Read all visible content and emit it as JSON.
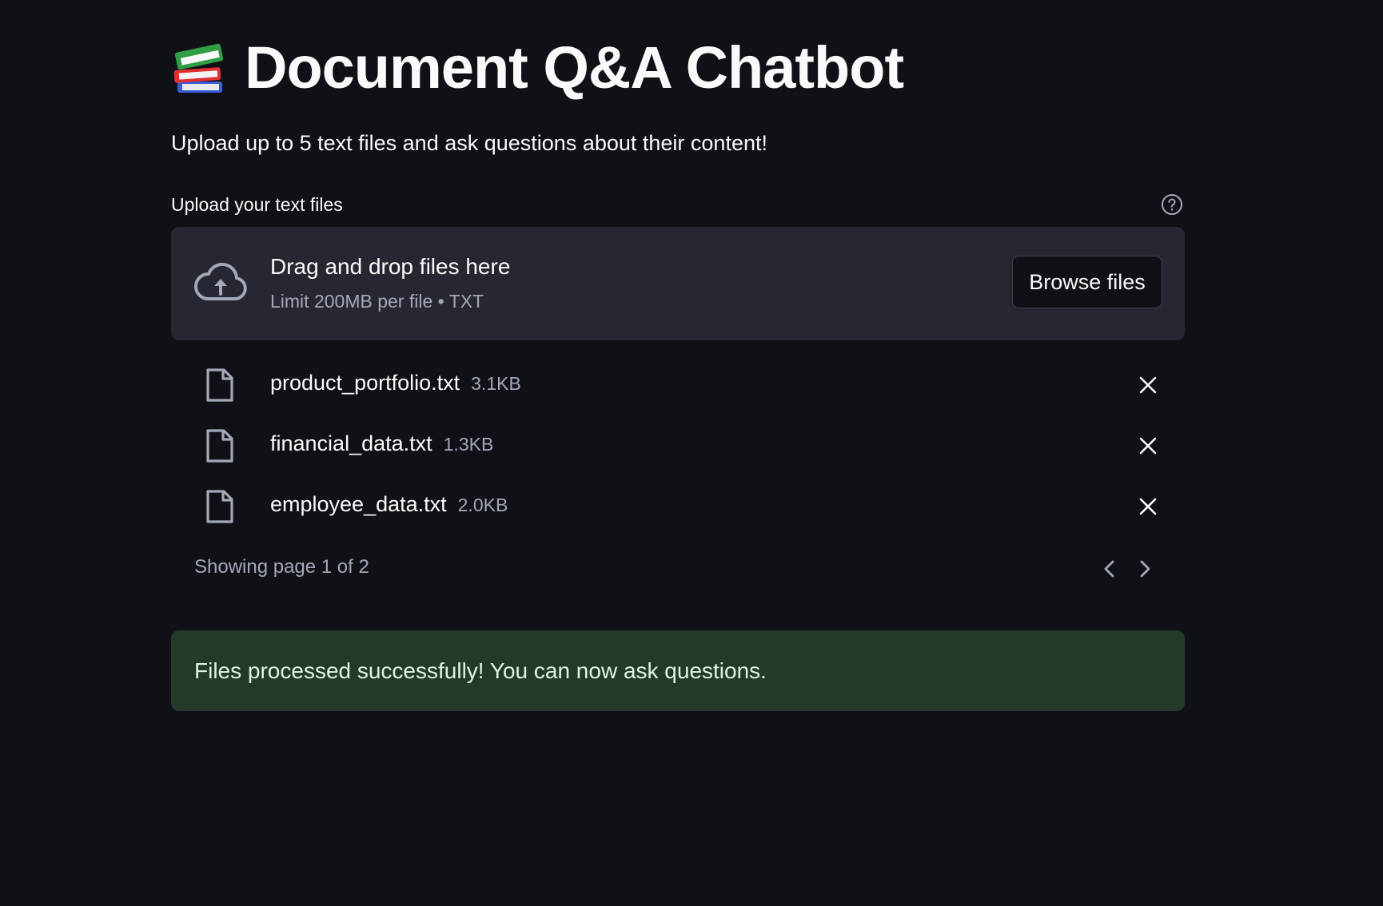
{
  "header": {
    "icon": "books-icon",
    "title": "Document Q&A Chatbot",
    "subtitle": "Upload up to 5 text files and ask questions about their content!"
  },
  "uploader": {
    "label": "Upload your text files",
    "help_icon": "question-circle-icon",
    "dropzone": {
      "icon": "cloud-upload-icon",
      "title": "Drag and drop files here",
      "limit": "Limit 200MB per file • TXT"
    },
    "browse_label": "Browse files",
    "files": [
      {
        "name": "product_portfolio.txt",
        "size": "3.1KB"
      },
      {
        "name": "financial_data.txt",
        "size": "1.3KB"
      },
      {
        "name": "employee_data.txt",
        "size": "2.0KB"
      }
    ],
    "pagination": {
      "text": "Showing page 1 of 2",
      "prev_icon": "chevron-left-icon",
      "next_icon": "chevron-right-icon"
    }
  },
  "alert": {
    "type": "success",
    "message": "Files processed successfully! You can now ask questions."
  },
  "colors": {
    "background": "#0f1117",
    "dropzone": "#262730",
    "success_bg": "#233a2b",
    "muted_text": "#a3a8b8"
  }
}
